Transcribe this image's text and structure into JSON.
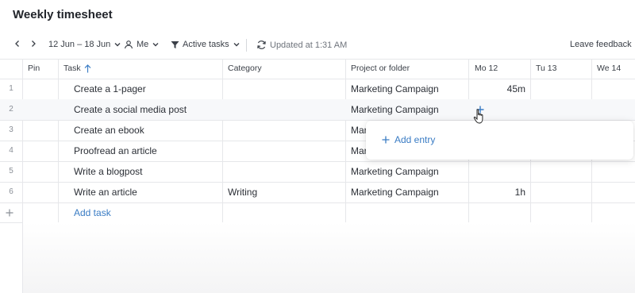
{
  "page": {
    "title": "Weekly timesheet"
  },
  "toolbar": {
    "date_range": "12 Jun – 18 Jun",
    "user_filter": "Me",
    "task_filter": "Active tasks",
    "updated": "Updated at 1:31 AM",
    "feedback": "Leave feedback"
  },
  "columns": {
    "pin": "Pin",
    "task": "Task",
    "category": "Category",
    "project": "Project or folder",
    "mo": "Mo 12",
    "tu": "Tu 13",
    "we": "We 14"
  },
  "rows": [
    {
      "num": "1",
      "task": "Create a 1-pager",
      "category": "",
      "project": "Marketing Campaign",
      "mo": "45m"
    },
    {
      "num": "2",
      "task": "Create a social media post",
      "category": "",
      "project": "Marketing Campaign",
      "mo": ""
    },
    {
      "num": "3",
      "task": "Create an ebook",
      "category": "",
      "project": "Marketing Campaign",
      "mo": ""
    },
    {
      "num": "4",
      "task": "Proofread an article",
      "category": "",
      "project": "Marketing Campaign",
      "mo": ""
    },
    {
      "num": "5",
      "task": "Write a blogpost",
      "category": "",
      "project": "Marketing Campaign",
      "mo": ""
    },
    {
      "num": "6",
      "task": "Write an article",
      "category": "Writing",
      "project": "Marketing Campaign",
      "mo": "1h"
    }
  ],
  "add_task": "Add task",
  "popup": {
    "add_entry": "Add entry"
  },
  "icons": {
    "prev": "chevron-left-icon",
    "next": "chevron-right-icon",
    "user": "user-icon",
    "filter": "filter-icon",
    "refresh": "refresh-icon",
    "sort": "sort-ascending-icon",
    "plus": "plus-icon",
    "cursor": "hand-pointer-icon"
  },
  "colors": {
    "accent": "#3a7cc4",
    "grid_line": "#e6e7ea"
  }
}
